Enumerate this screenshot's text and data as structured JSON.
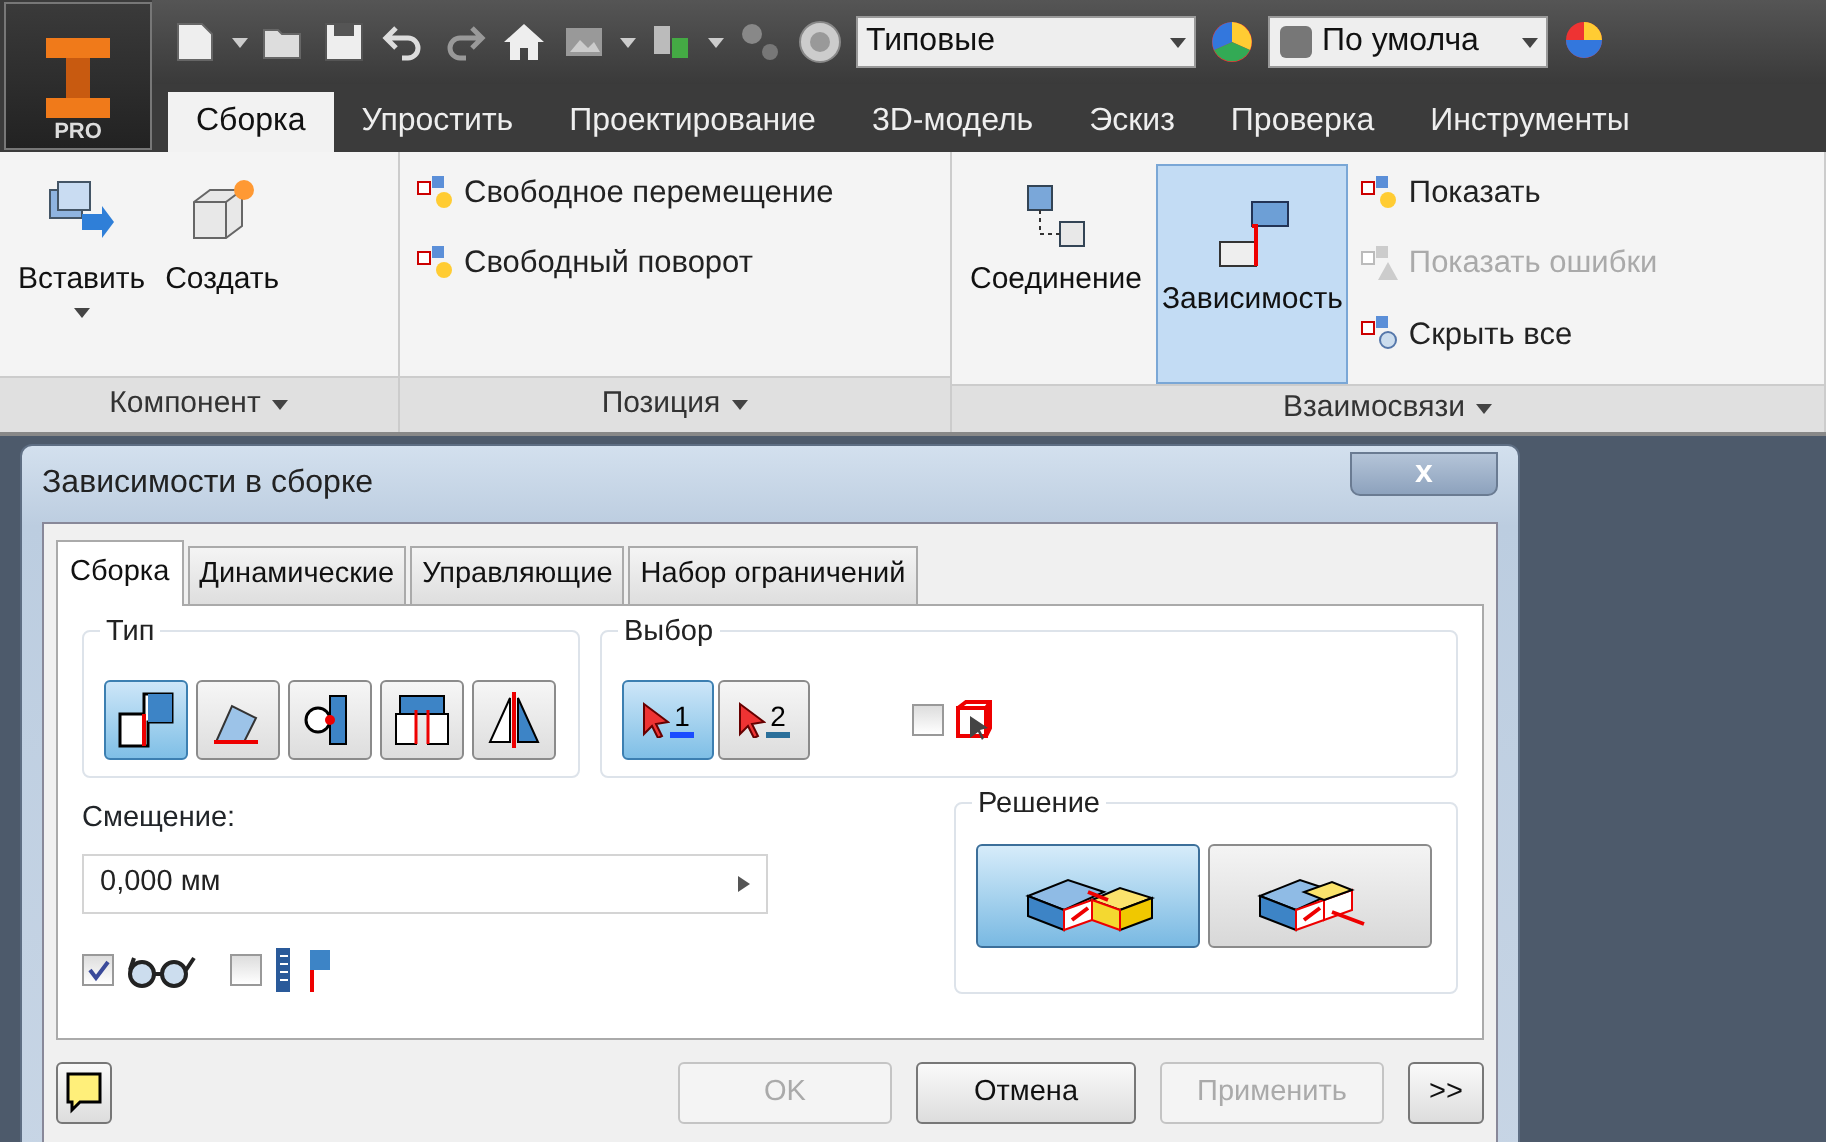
{
  "app_menu": {
    "label": "PRO"
  },
  "quick_access": {
    "combos": [
      {
        "value": "Типовые"
      },
      {
        "value": "По умолча"
      }
    ]
  },
  "ribbon_tabs": [
    {
      "label": "Сборка",
      "selected": true
    },
    {
      "label": "Упростить",
      "selected": false
    },
    {
      "label": "Проектирование",
      "selected": false
    },
    {
      "label": "3D-модель",
      "selected": false
    },
    {
      "label": "Эскиз",
      "selected": false
    },
    {
      "label": "Проверка",
      "selected": false
    },
    {
      "label": "Инструменты",
      "selected": false
    }
  ],
  "ribbon_panels": [
    {
      "title": "Компонент",
      "tools": [
        {
          "label": "Вставить",
          "kind": "large",
          "dropdown": true,
          "selected": false
        },
        {
          "label": "Создать",
          "kind": "large",
          "dropdown": false,
          "selected": false
        }
      ]
    },
    {
      "title": "Позиция",
      "tools": [
        {
          "label": "Свободное перемещение",
          "kind": "small",
          "disabled": false
        },
        {
          "label": "Свободный поворот",
          "kind": "small",
          "disabled": false
        }
      ]
    },
    {
      "title": "Взаимосвязи",
      "tools": [
        {
          "label": "Соединение",
          "kind": "large",
          "dropdown": false,
          "selected": false
        },
        {
          "label": "Зависимость",
          "kind": "large",
          "dropdown": false,
          "selected": true
        },
        {
          "label": "Показать",
          "kind": "small",
          "disabled": false
        },
        {
          "label": "Показать ошибки",
          "kind": "small",
          "disabled": true
        },
        {
          "label": "Скрыть все",
          "kind": "small",
          "disabled": false
        }
      ]
    }
  ],
  "dialog": {
    "title": "Зависимости в сборке",
    "close": "x",
    "tabs": [
      {
        "label": "Сборка",
        "selected": true
      },
      {
        "label": "Динамические",
        "selected": false
      },
      {
        "label": "Управляющие",
        "selected": false
      },
      {
        "label": "Набор ограничений",
        "selected": false
      }
    ],
    "type_group": {
      "legend": "Тип",
      "buttons": [
        {
          "selected": true
        },
        {
          "selected": false
        },
        {
          "selected": false
        },
        {
          "selected": false
        },
        {
          "selected": false
        }
      ]
    },
    "selection_group": {
      "legend": "Выбор",
      "buttons": [
        {
          "label": "1",
          "selected": true
        },
        {
          "label": "2",
          "selected": false
        }
      ],
      "checkbox": {
        "checked": false
      }
    },
    "offset": {
      "label": "Смещение:",
      "value": "0,000 мм"
    },
    "options": [
      {
        "checked": true
      },
      {
        "checked": false
      }
    ],
    "solution_group": {
      "legend": "Решение",
      "buttons": [
        {
          "selected": true
        },
        {
          "selected": false
        }
      ]
    },
    "footer_buttons": [
      {
        "label": "OK",
        "disabled": true
      },
      {
        "label": "Отмена",
        "disabled": false
      },
      {
        "label": "Применить",
        "disabled": true
      },
      {
        "label": ">>",
        "disabled": false
      }
    ]
  }
}
